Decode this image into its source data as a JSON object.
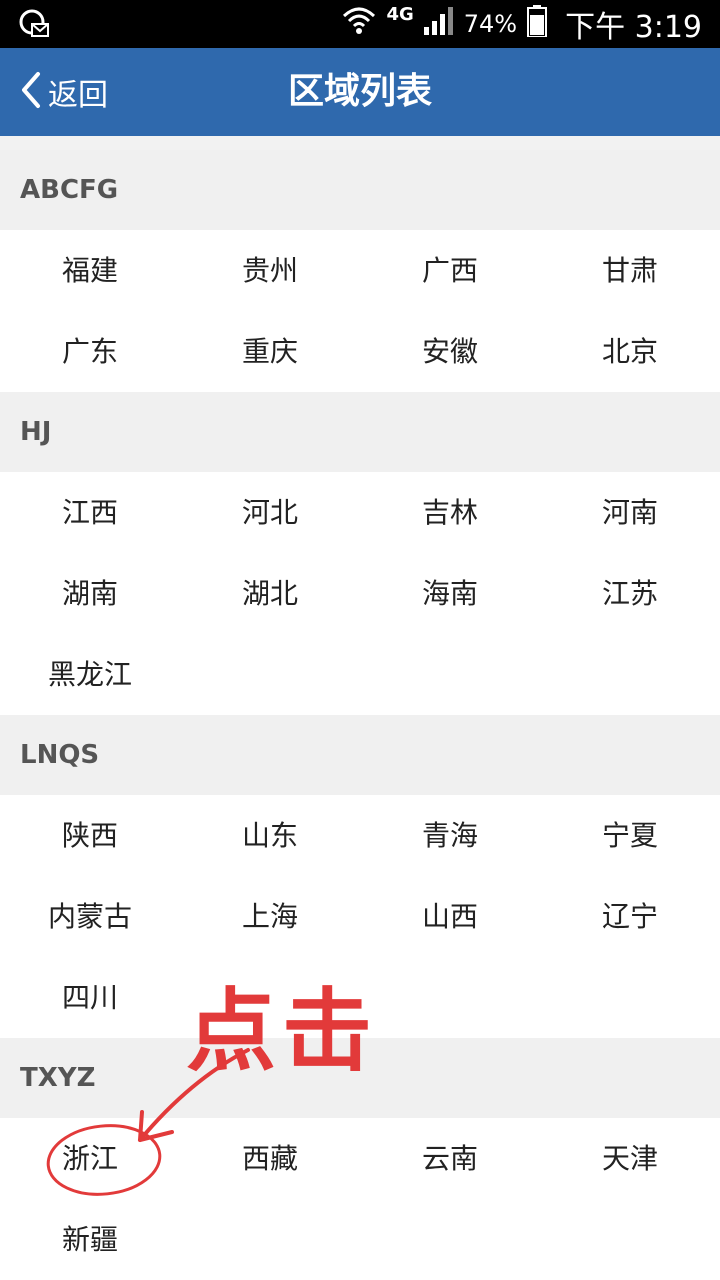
{
  "status_bar": {
    "network": "4G",
    "battery": "74%",
    "time": "下午 3:19"
  },
  "nav": {
    "back_label": "返回",
    "title": "区域列表"
  },
  "sections": [
    {
      "header": "ABCFG",
      "items": [
        "福建",
        "贵州",
        "广西",
        "甘肃",
        "广东",
        "重庆",
        "安徽",
        "北京"
      ]
    },
    {
      "header": "HJ",
      "items": [
        "江西",
        "河北",
        "吉林",
        "河南",
        "湖南",
        "湖北",
        "海南",
        "江苏",
        "黑龙江"
      ]
    },
    {
      "header": "LNQS",
      "items": [
        "陕西",
        "山东",
        "青海",
        "宁夏",
        "内蒙古",
        "上海",
        "山西",
        "辽宁",
        "四川"
      ]
    },
    {
      "header": "TXYZ",
      "items": [
        "浙江",
        "西藏",
        "云南",
        "天津",
        "新疆"
      ]
    }
  ],
  "annotation": {
    "text": "点击",
    "color": "#e23a3a"
  },
  "colors": {
    "nav_bg": "#2f69ad",
    "section_bg": "#f0f0f0"
  }
}
